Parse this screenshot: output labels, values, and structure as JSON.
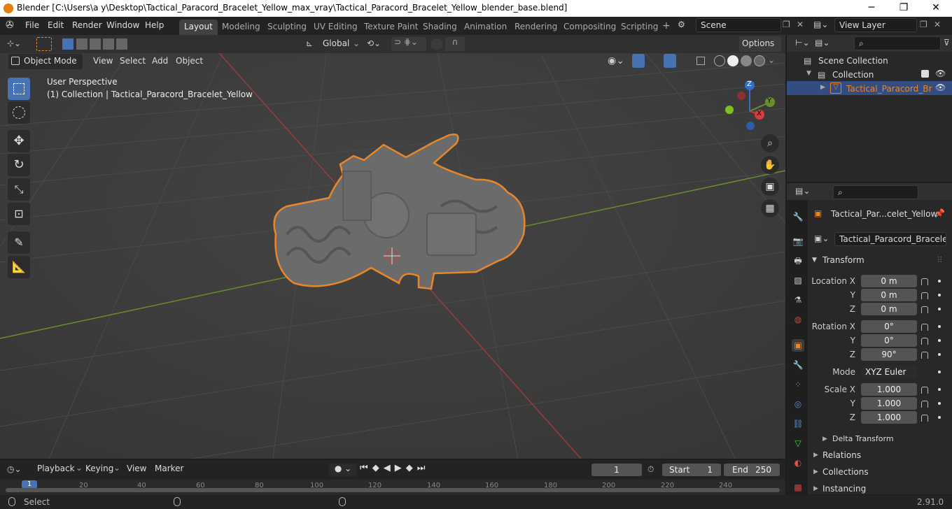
{
  "window": {
    "title": "Blender [C:\\Users\\a y\\Desktop\\Tactical_Paracord_Bracelet_Yellow_max_vray\\Tactical_Paracord_Bracelet_Yellow_blender_base.blend]"
  },
  "menu": [
    "File",
    "Edit",
    "Render",
    "Window",
    "Help"
  ],
  "workspaces": [
    "Layout",
    "Modeling",
    "Sculpting",
    "UV Editing",
    "Texture Paint",
    "Shading",
    "Animation",
    "Rendering",
    "Compositing",
    "Scripting"
  ],
  "scene": "Scene",
  "view_layer": "View Layer",
  "toolbar": {
    "orientation": "Global",
    "options": "Options"
  },
  "viewport": {
    "mode": "Object Mode",
    "menus": [
      "View",
      "Select",
      "Add",
      "Object"
    ],
    "perspective": "User Perspective",
    "collection_info": "(1) Collection | Tactical_Paracord_Bracelet_Yellow",
    "gizmo": {
      "z": "Z",
      "y": "Y",
      "x": "X"
    }
  },
  "outliner": {
    "scene_collection": "Scene Collection",
    "collection": "Collection",
    "object": "Tactical_Paracord_Br"
  },
  "properties": {
    "object_name": "Tactical_Par...celet_Yellow",
    "data_name": "Tactical_Paracord_Bracelet_...",
    "transform_label": "Transform",
    "location_label": "Location X",
    "rotation_label": "Rotation X",
    "scale_label": "Scale X",
    "y": "Y",
    "z": "Z",
    "location": [
      "0 m",
      "0 m",
      "0 m"
    ],
    "rotation": [
      "0°",
      "0°",
      "90°"
    ],
    "mode_label": "Mode",
    "mode_value": "XYZ Euler",
    "scale": [
      "1.000",
      "1.000",
      "1.000"
    ],
    "delta_transform": "Delta Transform",
    "relations": "Relations",
    "collections": "Collections",
    "instancing": "Instancing"
  },
  "timeline": {
    "menus": [
      "Playback",
      "Keying",
      "View",
      "Marker"
    ],
    "current_frame": "1",
    "start_label": "Start",
    "start": "1",
    "end_label": "End",
    "end": "250",
    "ruler": [
      "1",
      "20",
      "40",
      "60",
      "80",
      "100",
      "120",
      "140",
      "160",
      "180",
      "200",
      "220",
      "240"
    ]
  },
  "status": {
    "left": "Select",
    "version": "2.91.0"
  },
  "colors": {
    "accent": "#4772b3",
    "selection_outline": "#e8872a",
    "x_axis": "#9c3a3a",
    "y_axis": "#6a8f2a"
  }
}
